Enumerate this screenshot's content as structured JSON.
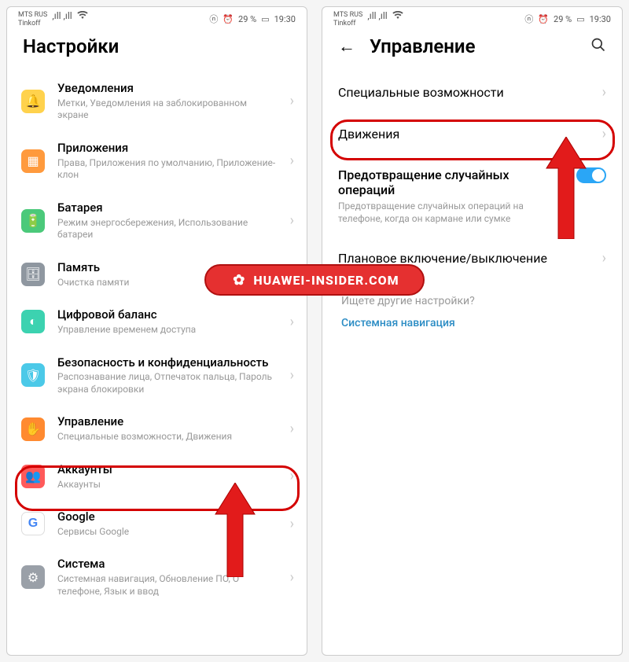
{
  "status": {
    "carrier1": "MTS RUS",
    "carrier2": "Tinkoff",
    "battery_pct": "29 %",
    "time": "19:30"
  },
  "left_screen": {
    "title": "Настройки",
    "items": [
      {
        "title": "Уведомления",
        "sub": "Метки, Уведомления на заблокированном экране"
      },
      {
        "title": "Приложения",
        "sub": "Права, Приложения по умолчанию, Приложение-клон"
      },
      {
        "title": "Батарея",
        "sub": "Режим энергосбережения, Использование батареи"
      },
      {
        "title": "Память",
        "sub": "Очистка памяти"
      },
      {
        "title": "Цифровой баланс",
        "sub": "Управление временем доступа"
      },
      {
        "title": "Безопасность и конфиденциальность",
        "sub": "Распознавание лица, Отпечаток пальца, Пароль экрана блокировки"
      },
      {
        "title": "Управление",
        "sub": "Специальные возможности, Движения"
      },
      {
        "title": "Аккаунты",
        "sub": "Аккаунты"
      },
      {
        "title": "Google",
        "sub": "Сервисы Google"
      },
      {
        "title": "Система",
        "sub": "Системная навигация, Обновление ПО, О телефоне, Язык и ввод"
      }
    ]
  },
  "right_screen": {
    "title": "Управление",
    "items": [
      {
        "title": "Специальные возможности"
      },
      {
        "title": "Движения"
      },
      {
        "title": "Предотвращение случайных операций",
        "sub": "Предотвращение случайных операций на телефоне, когда он кармане или сумке"
      },
      {
        "title": "Плановое включение/выключение"
      }
    ],
    "footer_hint": "Ищете другие настройки?",
    "footer_link": "Системная навигация"
  },
  "watermark": "HUAWEI-INSIDER.COM"
}
